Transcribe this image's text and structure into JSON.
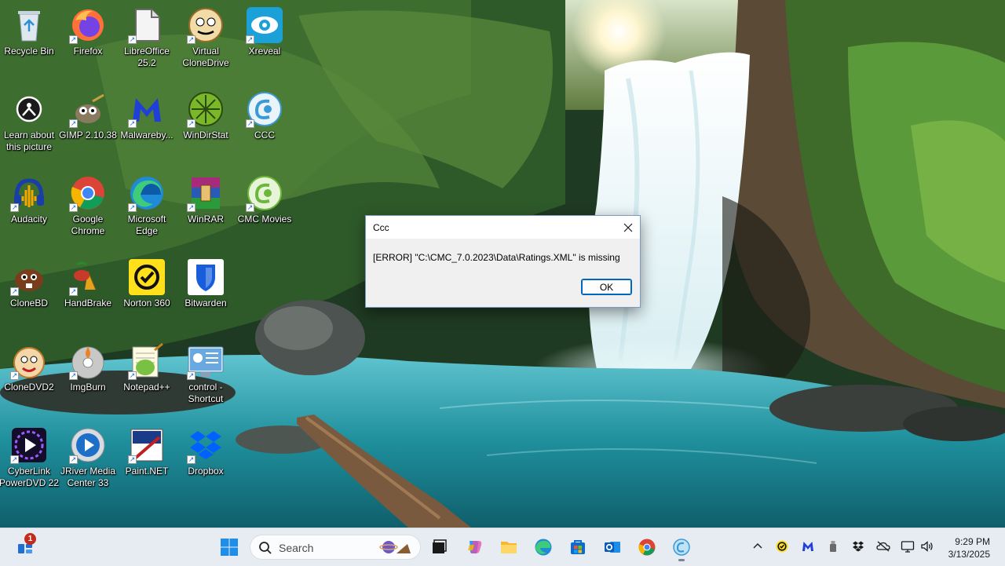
{
  "desktop": {
    "icons": [
      {
        "label": "Recycle Bin",
        "icon": "recycle-bin-icon"
      },
      {
        "label": "Firefox",
        "icon": "firefox-icon"
      },
      {
        "label": "LibreOffice 25.2",
        "icon": "libreoffice-icon"
      },
      {
        "label": "Virtual CloneDrive",
        "icon": "virtual-clonedrive-icon"
      },
      {
        "label": "Xreveal",
        "icon": "xreveal-icon"
      },
      {
        "label": "Learn about this picture",
        "icon": "learn-about-picture-icon"
      },
      {
        "label": "GIMP 2.10.38",
        "icon": "gimp-icon"
      },
      {
        "label": "Malwareby...",
        "icon": "malwarebytes-icon"
      },
      {
        "label": "WinDirStat",
        "icon": "windirstat-icon"
      },
      {
        "label": "CCC",
        "icon": "ccc-icon"
      },
      {
        "label": "Audacity",
        "icon": "audacity-icon"
      },
      {
        "label": "Google Chrome",
        "icon": "chrome-icon"
      },
      {
        "label": "Microsoft Edge",
        "icon": "edge-icon"
      },
      {
        "label": "WinRAR",
        "icon": "winrar-icon"
      },
      {
        "label": "CMC Movies",
        "icon": "cmc-movies-icon"
      },
      {
        "label": "CloneBD",
        "icon": "clonebd-icon"
      },
      {
        "label": "HandBrake",
        "icon": "handbrake-icon"
      },
      {
        "label": "Norton 360",
        "icon": "norton-icon"
      },
      {
        "label": "Bitwarden",
        "icon": "bitwarden-icon"
      },
      {
        "label": "CloneDVD2",
        "icon": "clonedvd2-icon"
      },
      {
        "label": "ImgBurn",
        "icon": "imgburn-icon"
      },
      {
        "label": "Notepad++",
        "icon": "notepadpp-icon"
      },
      {
        "label": "control - Shortcut",
        "icon": "control-panel-icon"
      },
      {
        "label": "CyberLink PowerDVD 22",
        "icon": "powerdvd-icon"
      },
      {
        "label": "JRiver Media Center 33",
        "icon": "jriver-icon"
      },
      {
        "label": "Paint.NET",
        "icon": "paintnet-icon"
      },
      {
        "label": "Dropbox",
        "icon": "dropbox-icon"
      }
    ]
  },
  "dialog": {
    "title": "Ccc",
    "message": "[ERROR] \"C:\\CMC_7.0.2023\\Data\\Ratings.XML\" is missing",
    "ok_label": "OK",
    "close_glyph": "✕"
  },
  "taskbar": {
    "widgets_badge": "1",
    "search_placeholder": "Search",
    "pinned": [
      "start-icon",
      "task-view-icon",
      "copilot-icon",
      "file-explorer-icon",
      "edge-icon",
      "microsoft-store-icon",
      "outlook-icon",
      "chrome-icon",
      "ccc-icon"
    ],
    "tray": [
      "chevron-up-icon",
      "norton-icon",
      "malwarebytes-icon",
      "usb-icon",
      "dropbox-icon",
      "onedrive-off-icon",
      "network-icon",
      "volume-icon"
    ],
    "time": "9:29 PM",
    "date": "3/13/2025"
  },
  "colors": {
    "accent": "#0067c0",
    "taskbar_bg": "#e6ecf2",
    "dialog_bg": "#f0f0f0"
  }
}
